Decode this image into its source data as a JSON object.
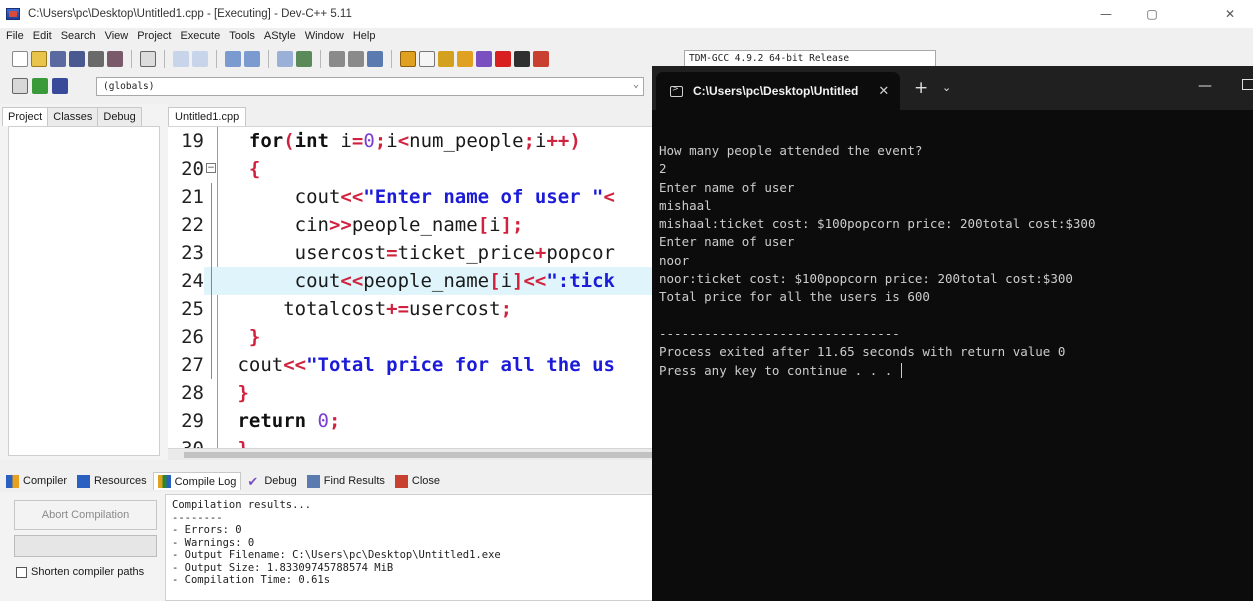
{
  "window": {
    "title": "C:\\Users\\pc\\Desktop\\Untitled1.cpp - [Executing] - Dev-C++ 5.11",
    "controls": {
      "minimize": "—",
      "restore": "▢",
      "close": "✕"
    }
  },
  "menu": [
    "File",
    "Edit",
    "Search",
    "View",
    "Project",
    "Execute",
    "Tools",
    "AStyle",
    "Window",
    "Help"
  ],
  "toolbar": {
    "compiler": "TDM-GCC 4.9.2 64-bit Release",
    "scope": "(globals)"
  },
  "left_panel": {
    "tabs": [
      "Project",
      "Classes",
      "Debug"
    ]
  },
  "editor": {
    "tab": "Untitled1.cpp",
    "line_numbers": [
      "19",
      "20",
      "21",
      "22",
      "23",
      "24",
      "25",
      "26",
      "27",
      "28",
      "29",
      "30"
    ],
    "code": [
      {
        "tokens": [
          [
            "kw",
            "  for"
          ],
          [
            "op",
            "("
          ],
          [
            "kw",
            "int "
          ],
          [
            "",
            "i"
          ],
          [
            "op",
            "="
          ],
          [
            "num",
            "0"
          ],
          [
            "op",
            ";"
          ],
          [
            "",
            "i"
          ],
          [
            "op",
            "<"
          ],
          [
            "",
            "num_people"
          ],
          [
            "op",
            ";"
          ],
          [
            "",
            "i"
          ],
          [
            "op",
            "++)"
          ]
        ]
      },
      {
        "tokens": [
          [
            "brace",
            "  {"
          ]
        ]
      },
      {
        "tokens": [
          [
            "",
            "      cout"
          ],
          [
            "op",
            "<<"
          ],
          [
            "str",
            "\"Enter name of user \""
          ],
          [
            "op",
            "<"
          ]
        ]
      },
      {
        "tokens": [
          [
            "",
            "      cin"
          ],
          [
            "op",
            ">>"
          ],
          [
            "",
            "people_name"
          ],
          [
            "op",
            "["
          ],
          [
            "",
            "i"
          ],
          [
            "op",
            "];"
          ]
        ]
      },
      {
        "tokens": [
          [
            "",
            "      usercost"
          ],
          [
            "op",
            "="
          ],
          [
            "",
            "ticket_price"
          ],
          [
            "op",
            "+"
          ],
          [
            "",
            "popcor"
          ]
        ]
      },
      {
        "tokens": [
          [
            "",
            "      cout"
          ],
          [
            "op",
            "<<"
          ],
          [
            "",
            "people_name"
          ],
          [
            "op",
            "["
          ],
          [
            "",
            "i"
          ],
          [
            "op",
            "]<<"
          ],
          [
            "str",
            "\":tick"
          ]
        ]
      },
      {
        "tokens": [
          [
            "",
            "     totalcost"
          ],
          [
            "op",
            "+="
          ],
          [
            "",
            "usercost"
          ],
          [
            "op",
            ";"
          ]
        ]
      },
      {
        "tokens": [
          [
            "brace",
            "  }"
          ]
        ]
      },
      {
        "tokens": [
          [
            "",
            " cout"
          ],
          [
            "op",
            "<<"
          ],
          [
            "str",
            "\"Total price for all the us"
          ]
        ]
      },
      {
        "tokens": [
          [
            "brace",
            " }"
          ]
        ]
      },
      {
        "tokens": [
          [
            "kw",
            " return "
          ],
          [
            "num",
            "0"
          ],
          [
            "op",
            ";"
          ]
        ]
      },
      {
        "tokens": [
          [
            "brace",
            " }"
          ]
        ]
      }
    ]
  },
  "bottom_tabs": [
    "Compiler",
    "Resources",
    "Compile Log",
    "Debug",
    "Find Results",
    "Close"
  ],
  "compile_panel": {
    "abort_button": "Abort Compilation",
    "shorten_paths_label": "Shorten compiler paths",
    "log": [
      "Compilation results...",
      "--------",
      "- Errors: 0",
      "- Warnings: 0",
      "- Output Filename: C:\\Users\\pc\\Desktop\\Untitled1.exe",
      "- Output Size: 1.83309745788574 MiB",
      "- Compilation Time: 0.61s"
    ]
  },
  "terminal": {
    "tab_title": "C:\\Users\\pc\\Desktop\\Untitled",
    "tab_close": "✕",
    "new_tab": "+",
    "dropdown": "⌄",
    "output": [
      "How many people attended the event?",
      "2",
      "Enter name of user",
      "mishaal",
      "mishaal:ticket cost: $100popcorn price: 200total cost:$300",
      "Enter name of user",
      "noor",
      "noor:ticket cost: $100popcorn price: 200total cost:$300",
      "Total price for all the users is 600",
      "",
      "--------------------------------",
      "Process exited after 11.65 seconds with return value 0",
      "Press any key to continue . . . "
    ]
  },
  "colors": {
    "terminal_bg": "#0c0c0c",
    "terminal_text": "#cccccc",
    "highlight_line": "#dff5fb",
    "operator": "#d0223e",
    "string": "#1b1bd8",
    "number": "#7a3fd1"
  }
}
